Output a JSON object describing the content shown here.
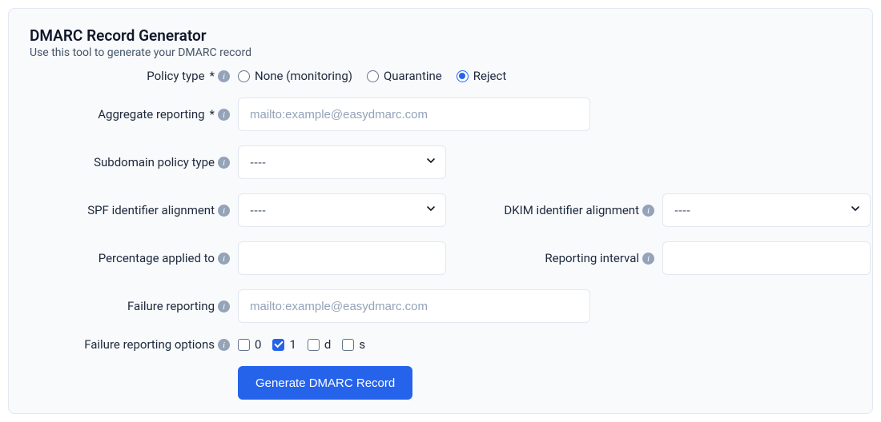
{
  "panel": {
    "title": "DMARC Record Generator",
    "subtitle": "Use this tool to generate your DMARC record"
  },
  "fields": {
    "policy_type": {
      "label": "Policy type",
      "required_mark": "*",
      "options": {
        "none": {
          "label": "None (monitoring)",
          "selected": false
        },
        "quar": {
          "label": "Quarantine",
          "selected": false
        },
        "reject": {
          "label": "Reject",
          "selected": true
        }
      }
    },
    "aggregate_reporting": {
      "label": "Aggregate reporting",
      "required_mark": "*",
      "placeholder": "mailto:example@easydmarc.com",
      "value": ""
    },
    "subdomain_policy": {
      "label": "Subdomain policy type",
      "value": "----"
    },
    "spf_alignment": {
      "label": "SPF identifier alignment",
      "value": "----"
    },
    "dkim_alignment": {
      "label": "DKIM identifier alignment",
      "value": "----"
    },
    "percentage": {
      "label": "Percentage applied to",
      "value": ""
    },
    "reporting_interval": {
      "label": "Reporting interval",
      "value": ""
    },
    "failure_reporting": {
      "label": "Failure reporting",
      "placeholder": "mailto:example@easydmarc.com",
      "value": ""
    },
    "failure_reporting_options": {
      "label": "Failure reporting options",
      "options": {
        "zero": {
          "label": "0",
          "checked": false
        },
        "one": {
          "label": "1",
          "checked": true
        },
        "d": {
          "label": "d",
          "checked": false
        },
        "s": {
          "label": "s",
          "checked": false
        }
      }
    }
  },
  "button": {
    "generate": "Generate DMARC Record"
  }
}
